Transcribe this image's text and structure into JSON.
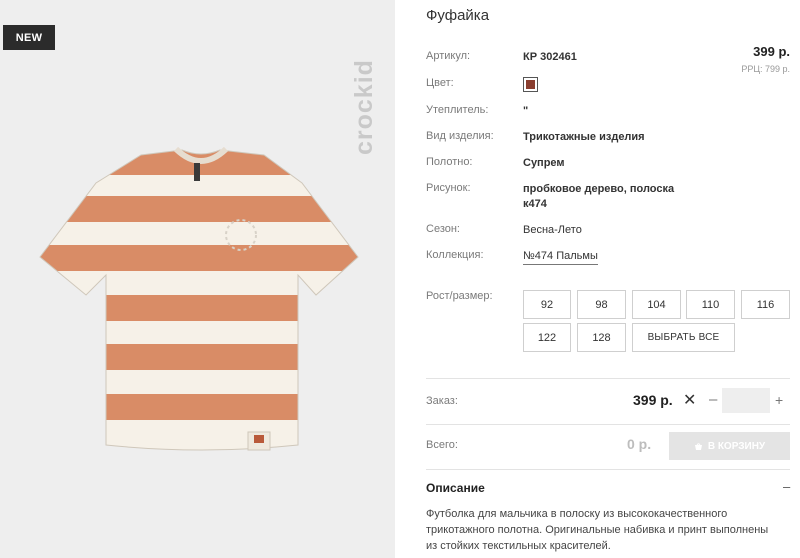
{
  "badge": "NEW",
  "brand_watermark": "crockid",
  "product": {
    "title": "Фуфайка",
    "price": "399 р.",
    "rrp": "РРЦ: 799 р.",
    "swatch_color": "#8a3e2f",
    "attributes": [
      {
        "label": "Артикул:",
        "value": "КР 302461"
      },
      {
        "label": "Цвет:",
        "value": ""
      },
      {
        "label": "Утеплитель:",
        "value": "\""
      },
      {
        "label": "Вид изделия:",
        "value": "Трикотажные изделия"
      },
      {
        "label": "Полотно:",
        "value": "Супрем"
      },
      {
        "label": "Рисунок:",
        "value": "пробковое дерево, полоска к474"
      },
      {
        "label": "Сезон:",
        "value": "Весна-Лето"
      },
      {
        "label": "Коллекция:",
        "value": "№474 Пальмы"
      }
    ]
  },
  "sizes": {
    "label": "Рост/размер:",
    "options": [
      "92",
      "98",
      "104",
      "110",
      "116",
      "122",
      "128"
    ],
    "select_all": "ВЫБРАТЬ ВСЕ"
  },
  "order": {
    "label": "Заказ:",
    "price": "399 р.",
    "times": "✕",
    "minus": "–",
    "plus": "+",
    "qty": ""
  },
  "total": {
    "label": "Всего:",
    "value": "0 р.",
    "cart_button": "В КОРЗИНУ"
  },
  "description": {
    "heading": "Описание",
    "toggle": "–",
    "text": "Футболка для мальчика в полоску из высококачественного трикотажного полотна. Оригинальные набивка и принт выполнены из стойких текстильных красителей."
  }
}
